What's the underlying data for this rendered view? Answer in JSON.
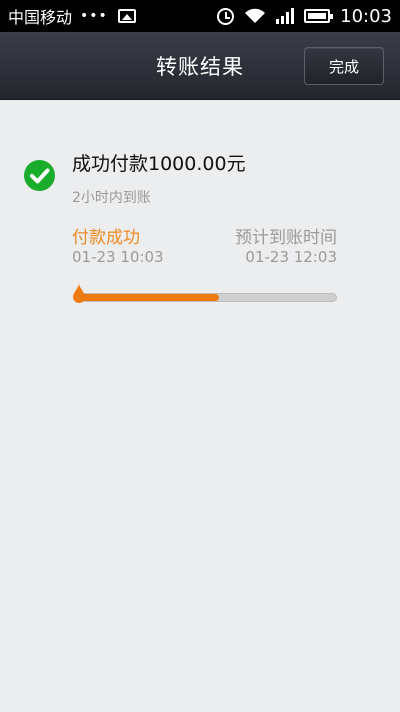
{
  "status_bar": {
    "carrier": "中国移动",
    "dots": "•••",
    "time": "10:03"
  },
  "header": {
    "title": "转账结果",
    "done_label": "完成"
  },
  "result": {
    "headline": "成功付款1000.00元",
    "subline": "2小时内到账",
    "step_left": {
      "title": "付款成功",
      "time": "01-23 10:03"
    },
    "step_right": {
      "title": "预计到账时间",
      "time": "01-23 12:03"
    },
    "progress_percent": 55
  },
  "colors": {
    "accent": "#f08a21",
    "success": "#1aac2b",
    "progress": "#ef7a10"
  },
  "icons": {
    "success": "check-circle-icon",
    "alarm": "alarm-icon",
    "wifi": "wifi-icon",
    "signal": "signal-icon",
    "battery": "battery-icon",
    "image": "image-icon"
  }
}
